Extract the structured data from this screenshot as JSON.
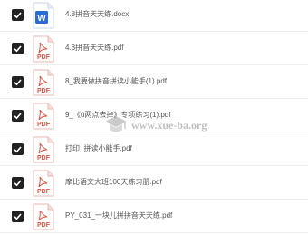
{
  "files": [
    {
      "name": "4.8拼音天天练.docx",
      "type": "docx",
      "icon": "word-file-icon",
      "icon_label": "W",
      "checked": true
    },
    {
      "name": "4.8拼音天天练.pdf",
      "type": "pdf",
      "icon": "pdf-file-icon",
      "icon_label": "PDF",
      "checked": true
    },
    {
      "name": "8_我要做拼音拼读小能手(1).pdf",
      "type": "pdf",
      "icon": "pdf-file-icon",
      "icon_label": "PDF",
      "checked": true
    },
    {
      "name": "9_《ü两点去掉》专项练习(1).pdf",
      "type": "pdf",
      "icon": "pdf-file-icon",
      "icon_label": "PDF",
      "checked": true
    },
    {
      "name": "打印_拼读小能手.pdf",
      "type": "pdf",
      "icon": "pdf-file-icon",
      "icon_label": "PDF",
      "checked": true
    },
    {
      "name": "摩比语文大班100天练习册.pdf",
      "type": "pdf",
      "icon": "pdf-file-icon",
      "icon_label": "PDF",
      "checked": true
    },
    {
      "name": "PY_031_一块儿拼拼音天天练.pdf",
      "type": "pdf",
      "icon": "pdf-file-icon",
      "icon_label": "PDF",
      "checked": true
    }
  ],
  "watermark": {
    "text": "www.xue-ba.org"
  },
  "colors": {
    "pdf_red": "#e5503f",
    "word_blue": "#2b6bd6",
    "checkbox": "#222222"
  }
}
